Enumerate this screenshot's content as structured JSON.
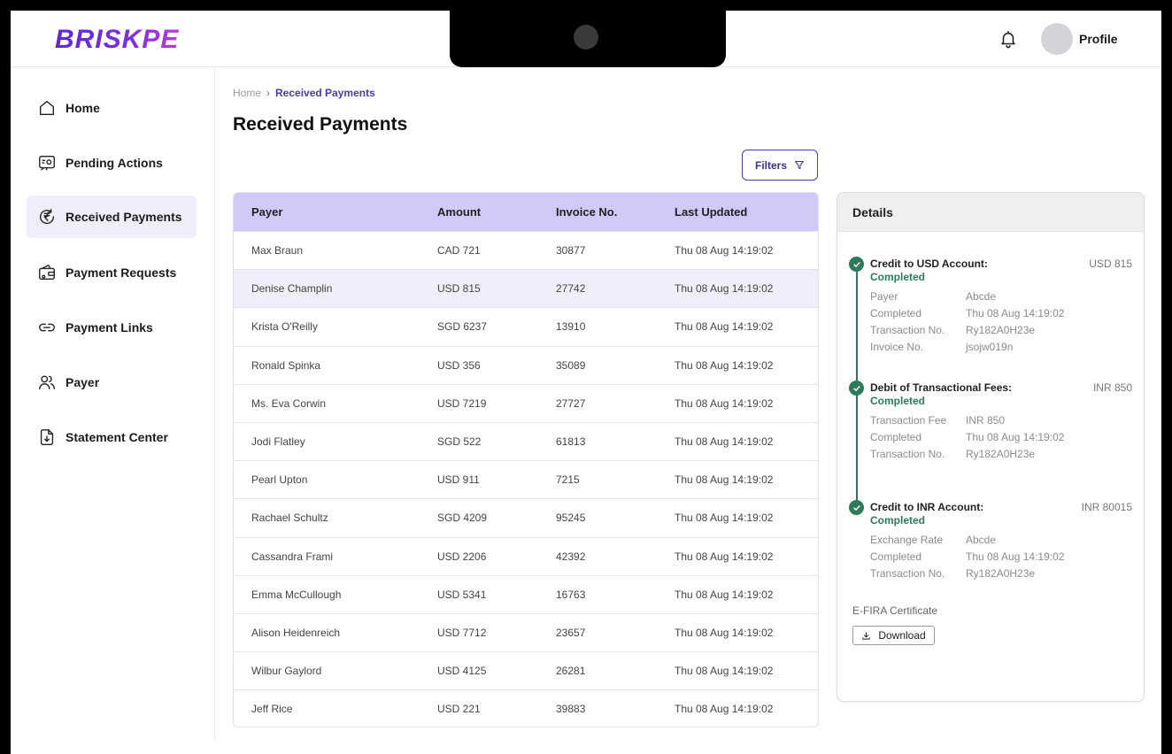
{
  "brand": {
    "logo_text": "BRISKPE",
    "accent": "#4b3aa8"
  },
  "header": {
    "profile_label": "Profile",
    "bell_icon": "bell-icon"
  },
  "sidebar": {
    "items": [
      {
        "label": "Home",
        "icon": "home-icon"
      },
      {
        "label": "Pending Actions",
        "icon": "pending-actions-icon"
      },
      {
        "label": "Received Payments",
        "icon": "rupee-refresh-icon",
        "active": true
      },
      {
        "label": "Payment Requests",
        "icon": "wallet-request-icon"
      },
      {
        "label": "Payment Links",
        "icon": "link-icon"
      },
      {
        "label": "Payer",
        "icon": "users-icon"
      },
      {
        "label": "Statement Center",
        "icon": "document-download-icon"
      }
    ]
  },
  "breadcrumb": {
    "home": "Home",
    "current": "Received Payments"
  },
  "page": {
    "title": "Received Payments"
  },
  "toolbar": {
    "filters_label": "Filters"
  },
  "table": {
    "headers": [
      "Payer",
      "Amount",
      "Invoice No.",
      "Last Updated"
    ],
    "rows": [
      [
        "Max Braun",
        "CAD 721",
        "30877",
        "Thu 08 Aug 14:19:02"
      ],
      [
        "Denise Champlin",
        "USD 815",
        "27742",
        "Thu 08 Aug 14:19:02"
      ],
      [
        "Krista O'Reilly",
        "SGD 6237",
        "13910",
        "Thu 08 Aug 14:19:02"
      ],
      [
        "Ronald Spinka",
        "USD 356",
        "35089",
        "Thu 08 Aug 14:19:02"
      ],
      [
        "Ms. Eva Corwin",
        "USD 7219",
        "27727",
        "Thu 08 Aug 14:19:02"
      ],
      [
        "Jodi Flatley",
        "SGD 522",
        "61813",
        "Thu 08 Aug 14:19:02"
      ],
      [
        "Pearl Upton",
        "USD 911",
        "7215",
        "Thu 08 Aug 14:19:02"
      ],
      [
        "Rachael Schultz",
        "SGD 4209",
        "95245",
        "Thu 08 Aug 14:19:02"
      ],
      [
        "Cassandra Frami",
        "USD 2206",
        "42392",
        "Thu 08 Aug 14:19:02"
      ],
      [
        "Emma McCullough",
        "USD 5341",
        "16763",
        "Thu 08 Aug 14:19:02"
      ],
      [
        "Alison Heidenreich",
        "USD 7712",
        "23657",
        "Thu 08 Aug 14:19:02"
      ],
      [
        "Wilbur Gaylord",
        "USD 4125",
        "26281",
        "Thu 08 Aug 14:19:02"
      ],
      [
        "Jeff Rice",
        "USD 221",
        "39883",
        "Thu 08 Aug 14:19:02"
      ]
    ],
    "selected_row": 1
  },
  "details": {
    "title": "Details",
    "steps": [
      {
        "title": "Credit to USD Account:",
        "status": "Completed",
        "amount": "USD 815",
        "fields": [
          {
            "k": "Payer",
            "v": "Abcde"
          },
          {
            "k": "Completed",
            "v": "Thu 08 Aug 14:19:02"
          },
          {
            "k": "Transaction No.",
            "v": "Ry182A0H23e"
          },
          {
            "k": "Invoice No.",
            "v": "jsojw019n"
          }
        ]
      },
      {
        "title": "Debit of Transactional Fees:",
        "status": "Completed",
        "amount": "INR 850",
        "fields": [
          {
            "k": "Transaction Fee",
            "v": "INR 850"
          },
          {
            "k": "Completed",
            "v": "Thu 08 Aug 14:19:02"
          },
          {
            "k": "Transaction No.",
            "v": "Ry182A0H23e"
          }
        ]
      },
      {
        "title": "Credit to INR Account:",
        "status": "Completed",
        "amount": "INR 80015",
        "fields": [
          {
            "k": "Exchange Rate",
            "v": "Abcde"
          },
          {
            "k": "Completed",
            "v": "Thu 08 Aug 14:19:02"
          },
          {
            "k": "Transaction No.",
            "v": "Ry182A0H23e"
          }
        ]
      }
    ],
    "efira_label": "E-FIRA Certificate",
    "download_label": "Download",
    "status_color": "#2f7a5a"
  }
}
